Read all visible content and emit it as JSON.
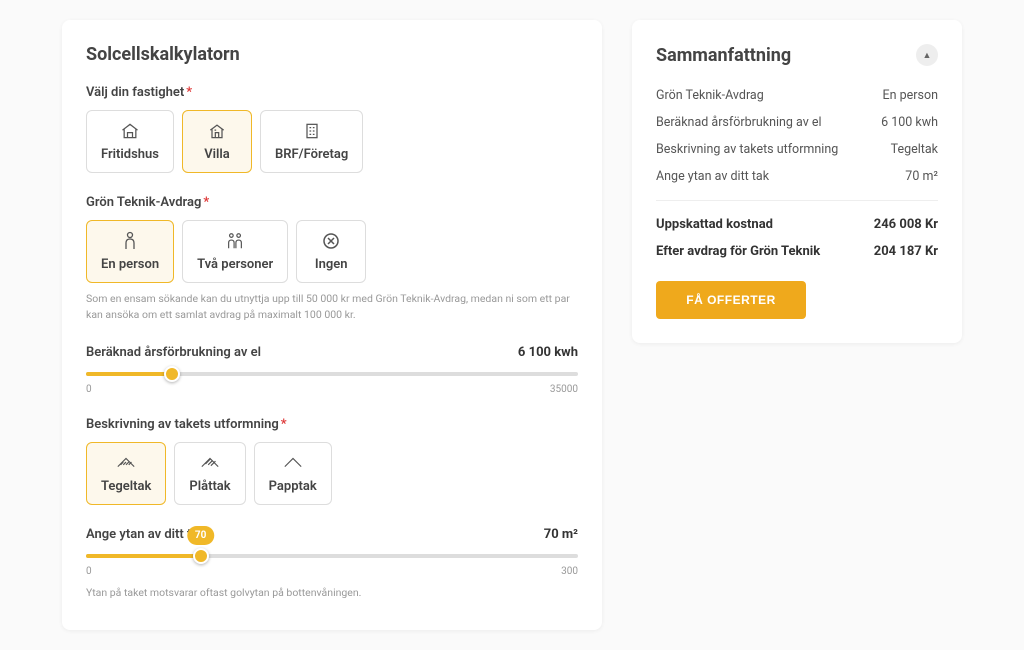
{
  "calculator": {
    "title": "Solcellskalkylatorn",
    "property": {
      "label": "Välj din fastighet",
      "options": [
        "Fritidshus",
        "Villa",
        "BRF/Företag"
      ],
      "selected": 1
    },
    "deduction": {
      "label": "Grön Teknik-Avdrag",
      "options": [
        "En person",
        "Två personer",
        "Ingen"
      ],
      "selected": 0,
      "helper": "Som en ensam sökande kan du utnyttja upp till 50 000 kr med Grön Teknik-Avdrag, medan ni som ett par kan ansöka om ett samlat avdrag på maximalt 100 000 kr."
    },
    "consumption": {
      "label": "Beräknad årsförbrukning av el",
      "value": "6 100 kwh",
      "min": "0",
      "max": "35000",
      "percent": 17.4
    },
    "roof": {
      "label": "Beskrivning av takets utformning",
      "options": [
        "Tegeltak",
        "Plåttak",
        "Papptak"
      ],
      "selected": 0
    },
    "area": {
      "label": "Ange ytan av ditt tak",
      "value": "70 m²",
      "tooltip": "70",
      "min": "0",
      "max": "300",
      "percent": 23.3,
      "helper": "Ytan på taket motsvarar oftast golvytan på bottenvåningen."
    }
  },
  "summary": {
    "title": "Sammanfattning",
    "rows": [
      {
        "label": "Grön Teknik-Avdrag",
        "value": "En person"
      },
      {
        "label": "Beräknad årsförbrukning av el",
        "value": "6 100 kwh"
      },
      {
        "label": "Beskrivning av takets utformning",
        "value": "Tegeltak"
      },
      {
        "label": "Ange ytan av ditt tak",
        "value": "70 m²"
      }
    ],
    "totals": [
      {
        "label": "Uppskattad kostnad",
        "value": "246 008 Kr"
      },
      {
        "label": "Efter avdrag för Grön Teknik",
        "value": "204 187 Kr"
      }
    ],
    "cta": "FÅ OFFERTER"
  }
}
